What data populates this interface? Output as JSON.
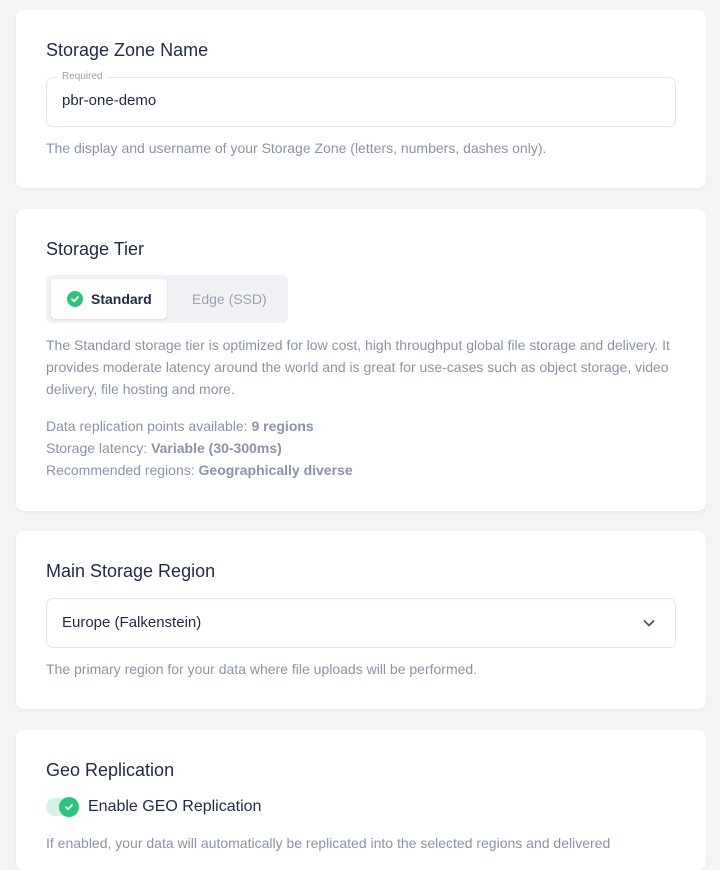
{
  "storage_zone": {
    "title": "Storage Zone Name",
    "field_label": "Required",
    "value": "pbr-one-demo",
    "help": "The display and username of your Storage Zone (letters, numbers, dashes only)."
  },
  "storage_tier": {
    "title": "Storage Tier",
    "options": [
      {
        "label": "Standard",
        "selected": true
      },
      {
        "label": "Edge (SSD)",
        "selected": false
      }
    ],
    "description": "The Standard storage tier is optimized for low cost, high throughput global file storage and delivery. It provides moderate latency around the world and is great for use-cases such as object storage, video delivery, file hosting and more.",
    "stats": [
      {
        "label": "Data replication points available:",
        "value": "9 regions"
      },
      {
        "label": "Storage latency:",
        "value": "Variable (30-300ms)"
      },
      {
        "label": "Recommended regions:",
        "value": "Geographically diverse"
      }
    ]
  },
  "main_region": {
    "title": "Main Storage Region",
    "selected": "Europe (Falkenstein)",
    "help": "The primary region for your data where file uploads will be performed."
  },
  "geo_replication": {
    "title": "Geo Replication",
    "toggle_label": "Enable GEO Replication",
    "enabled": true,
    "help": "If enabled, your data will automatically be replicated into the selected regions and delivered"
  },
  "colors": {
    "accent_green": "#2ec27e",
    "background": "#f4f4f6",
    "card": "#ffffff",
    "text": "#1f2a44",
    "muted": "#8a93a6"
  }
}
